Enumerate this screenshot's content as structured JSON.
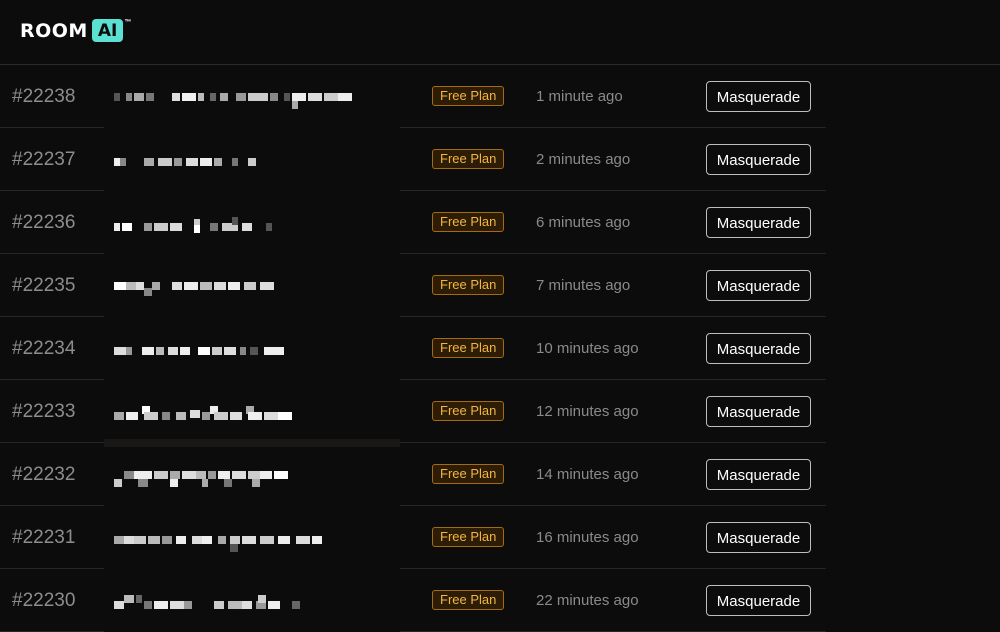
{
  "header": {
    "logo_room": "ROOM",
    "logo_ai": "AI",
    "logo_tm": "™"
  },
  "colors": {
    "background": "#0c0c0c",
    "accent_logo": "#5ce0d2",
    "badge_text": "#f3b63f",
    "badge_border": "#a66a12"
  },
  "users": [
    {
      "id": "#22238",
      "plan": "Free Plan",
      "time": "1 minute ago",
      "action": "Masquerade"
    },
    {
      "id": "#22237",
      "plan": "Free Plan",
      "time": "2 minutes ago",
      "action": "Masquerade"
    },
    {
      "id": "#22236",
      "plan": "Free Plan",
      "time": "6 minutes ago",
      "action": "Masquerade"
    },
    {
      "id": "#22235",
      "plan": "Free Plan",
      "time": "7 minutes ago",
      "action": "Masquerade"
    },
    {
      "id": "#22234",
      "plan": "Free Plan",
      "time": "10 minutes ago",
      "action": "Masquerade"
    },
    {
      "id": "#22233",
      "plan": "Free Plan",
      "time": "12 minutes ago",
      "action": "Masquerade"
    },
    {
      "id": "#22232",
      "plan": "Free Plan",
      "time": "14 minutes ago",
      "action": "Masquerade"
    },
    {
      "id": "#22231",
      "plan": "Free Plan",
      "time": "16 minutes ago",
      "action": "Masquerade"
    },
    {
      "id": "#22230",
      "plan": "Free Plan",
      "time": "22 minutes ago",
      "action": "Masquerade"
    }
  ]
}
